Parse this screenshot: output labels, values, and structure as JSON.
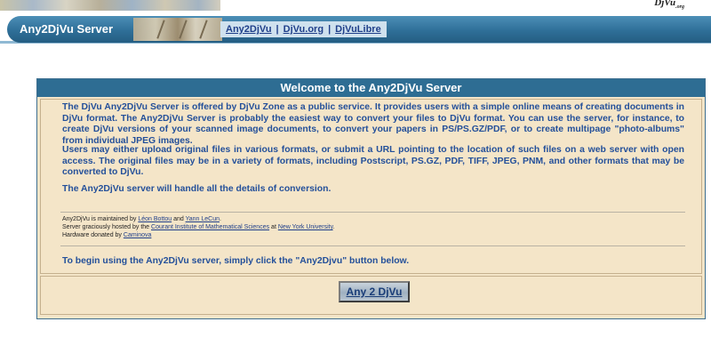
{
  "header": {
    "brand_corner": "DjVu",
    "title": "Any2DjVu Server",
    "links": [
      "Any2DjVu",
      "DjVu.org",
      "DjVuLibre"
    ],
    "separator": "|"
  },
  "panel": {
    "title": "Welcome to the Any2DjVu Server",
    "paragraph1": "The DjVu Any2DjVu Server is offered by DjVu Zone as a public service. It provides users with a simple online means of creating documents in DjVu format. The Any2DjVu Server is probably the easiest way to convert your files to DjVu format. You can use the server, for instance, to create DjVu versions of your scanned image documents, to convert your papers in PS/PS.GZ/PDF, or to create multipage \"photo-albums\" from individual JPEG images.",
    "paragraph2": "Users may either upload original files in various formats, or submit a URL pointing to the location of such files on a web server with open access. The original files may be in a variety of formats, including Postscript, PS.GZ, PDF, TIFF, JPEG, PNM, and other formats that may be converted to DjVu.",
    "paragraph3": "The Any2DjVu server will handle all the details of conversion.",
    "credits": {
      "line1_prefix": "Any2DjVu is maintained by",
      "person1": "Léon Bottou",
      "and": "and",
      "person2": "Yann LeCun",
      "line1_suffix": ".",
      "line2_prefix": "Server graciously hosted by the",
      "host": "Courant Institute of Mathematical Sciences",
      "at": "at",
      "university": "New York University",
      "line2_suffix": ".",
      "line3_prefix": "Hardware donated by",
      "donor": "Caminova"
    },
    "instruction": "To begin using the Any2DjVu server, simply click the \"Any2Djvu\" button below.",
    "button_label": "Any 2 DjVu"
  },
  "colors": {
    "nav_blue": "#2f6f98",
    "panel_bg": "#f4e5c8",
    "text_blue": "#24509a"
  }
}
